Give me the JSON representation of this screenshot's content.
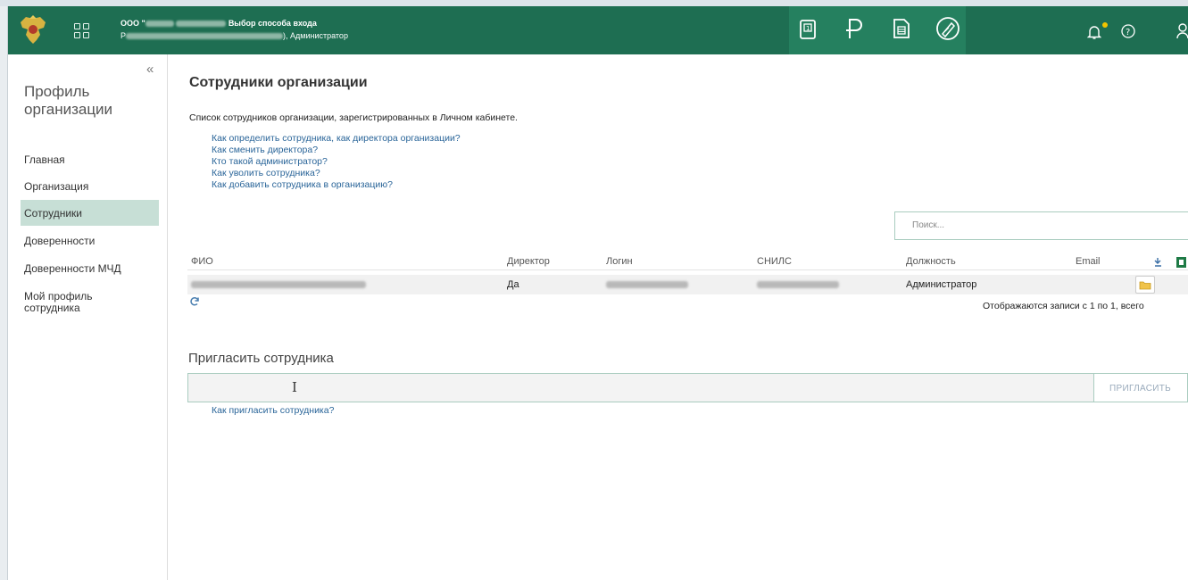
{
  "header": {
    "org_prefix": "ООО \"",
    "title": "Выбор способа входа",
    "org_prefix2": "Р",
    "role": "), Администратор",
    "colors": {
      "bg": "#1e6e52",
      "accent": "#25805f",
      "notify": "#f2c400"
    },
    "icons": [
      "logo-emblem-icon",
      "apps-grid-icon",
      "document-icon",
      "ruble-icon",
      "report-icon",
      "signature-icon",
      "bell-icon",
      "help-icon",
      "user-icon"
    ]
  },
  "sidebar": {
    "collapse_label": "«",
    "title": "Профиль организации",
    "items": [
      {
        "label": "Главная"
      },
      {
        "label": "Организация"
      },
      {
        "label": "Сотрудники"
      },
      {
        "label": "Доверенности"
      },
      {
        "label": "Доверенности МЧД"
      },
      {
        "label": "Мой профиль сотрудника"
      }
    ]
  },
  "main": {
    "title": "Сотрудники организации",
    "description": "Список сотрудников организации, зарегистрированных в Личном кабинете.",
    "help_links": [
      "Как определить сотрудника, как директора организации?",
      "Как сменить директора?",
      "Кто такой администратор?",
      "Как уволить сотрудника?",
      "Как добавить сотрудника в организацию?"
    ],
    "search_placeholder": "Поиск...",
    "table": {
      "headers": [
        "ФИО",
        "Директор",
        "Логин",
        "СНИЛС",
        "Должность",
        "Email"
      ],
      "rows": [
        {
          "director": "Да",
          "position": "Администратор"
        }
      ]
    },
    "records_text": "Отображаются записи с 1 по 1, всего",
    "invite": {
      "title": "Пригласить сотрудника",
      "button": "ПРИГЛАСИТЬ",
      "help": "Как пригласить сотрудника?"
    }
  }
}
